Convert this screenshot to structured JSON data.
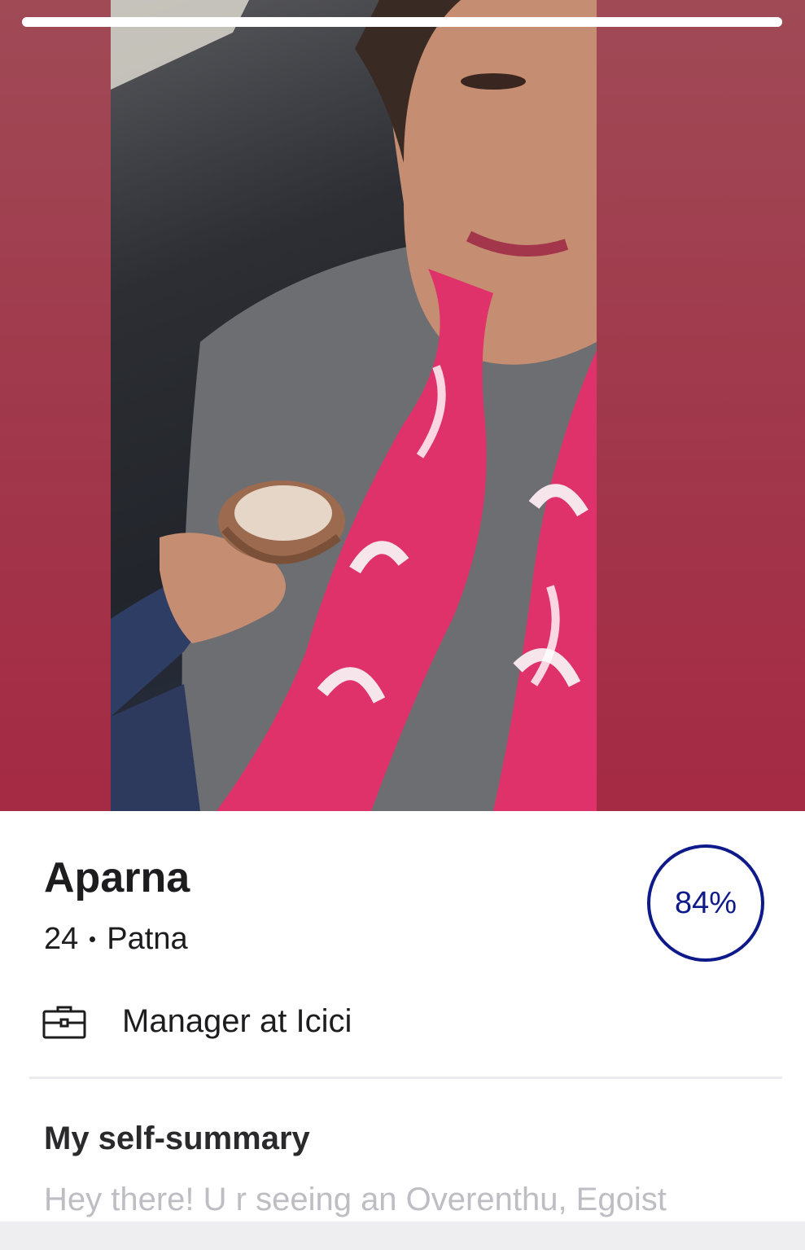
{
  "profile": {
    "name": "Aparna",
    "age": "24",
    "location": "Patna",
    "match_percent": "84%",
    "job": "Manager at Icici",
    "job_icon": "briefcase-icon"
  },
  "photo_carousel": {
    "photo_count": 1,
    "current_index": 1,
    "progress_fraction": 1.0
  },
  "summary": {
    "title": "My self-summary",
    "preview": "Hey there! U r seeing an Overenthu, Egoist"
  },
  "colors": {
    "match_ring": "#0f1a8a",
    "photo_background": "#a03a4c",
    "scarf_pink": "#e0326a"
  }
}
